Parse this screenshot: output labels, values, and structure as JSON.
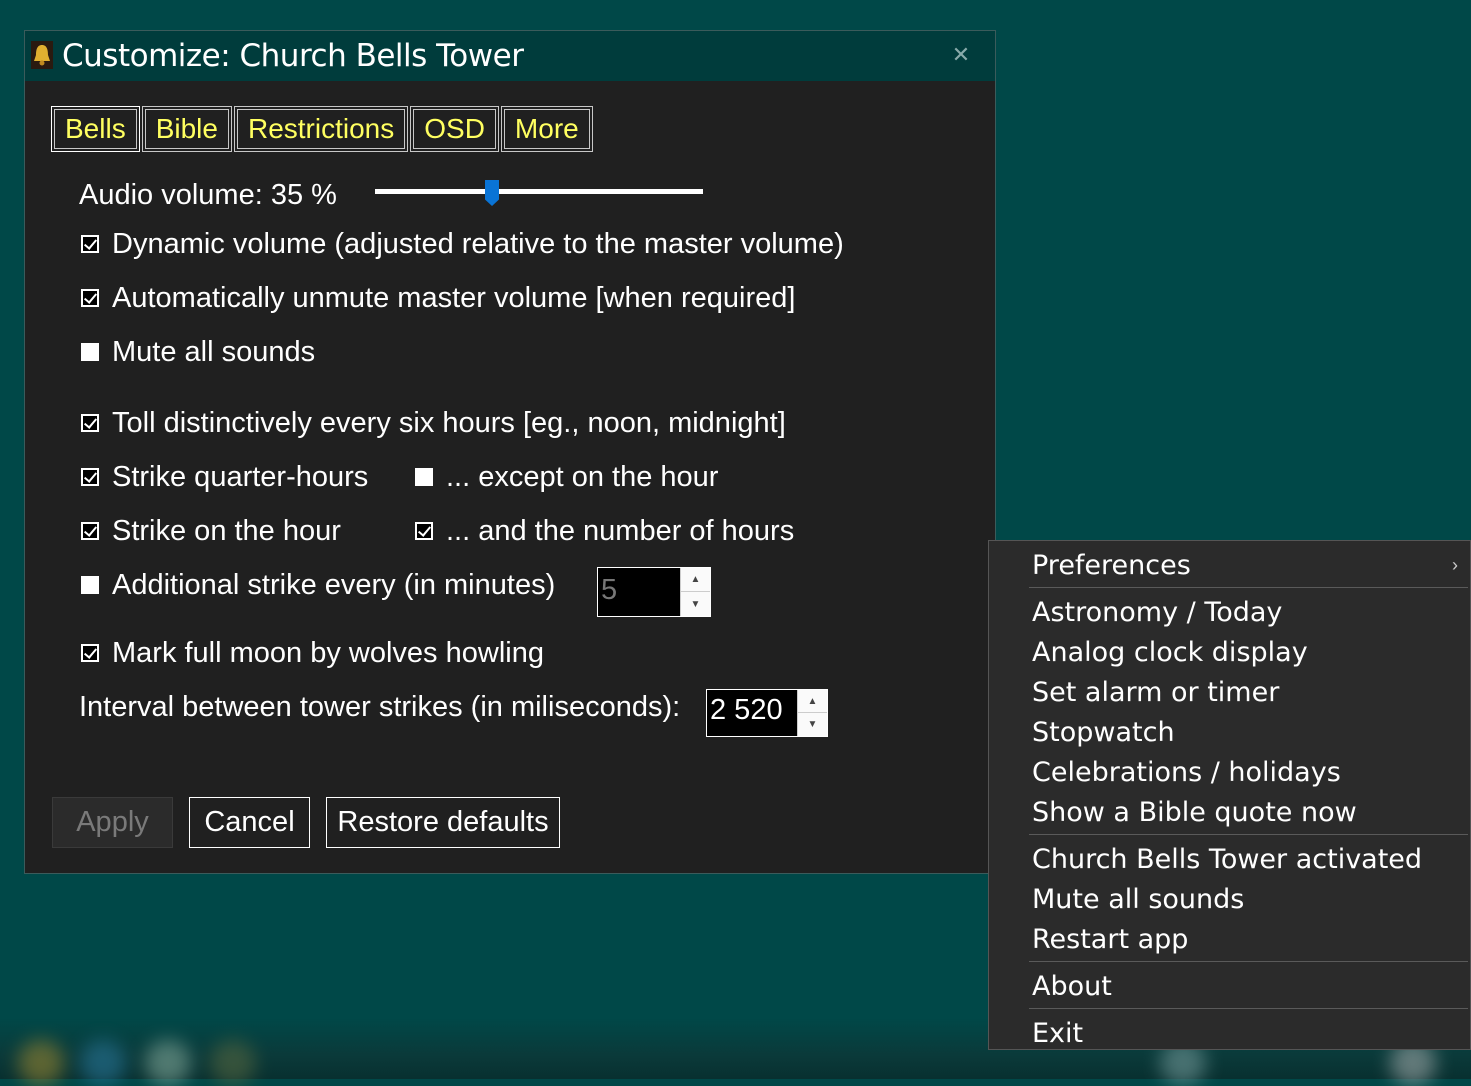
{
  "window": {
    "title": "Customize: Church Bells Tower",
    "close_glyph": "✕",
    "icon": "bell-icon"
  },
  "tabs": [
    "Bells",
    "Bible",
    "Restrictions",
    "OSD",
    "More"
  ],
  "bells": {
    "audio_volume_label": "Audio volume: 35 %",
    "audio_volume_percent": 35,
    "dynamic_volume": {
      "label": "Dynamic volume (adjusted relative to the master volume)",
      "checked": true
    },
    "auto_unmute": {
      "label": "Automatically unmute master volume [when required]",
      "checked": true
    },
    "mute_all": {
      "label": "Mute all sounds",
      "checked": false
    },
    "toll_six_hours": {
      "label": "Toll distinctively every six hours [eg., noon, midnight]",
      "checked": true
    },
    "strike_quarter": {
      "label": "Strike quarter-hours",
      "checked": true
    },
    "except_on_hour": {
      "label": "... except on the hour",
      "checked": false
    },
    "strike_hour": {
      "label": "Strike on the hour",
      "checked": true
    },
    "number_of_hours": {
      "label": "... and the number of hours",
      "checked": true
    },
    "additional_strike": {
      "label": "Additional strike every (in minutes)",
      "checked": false,
      "value": "5"
    },
    "full_moon": {
      "label": "Mark full moon by wolves howling",
      "checked": true
    },
    "interval_label": "Interval between tower strikes (in miliseconds):",
    "interval_value": "2 520"
  },
  "buttons": {
    "apply": "Apply",
    "cancel": "Cancel",
    "restore": "Restore defaults"
  },
  "context_menu": {
    "items": [
      "Preferences",
      "Astronomy / Today",
      "Analog clock display",
      "Set alarm or timer",
      "Stopwatch",
      "Celebrations / holidays",
      "Show a Bible quote now",
      "Church Bells Tower activated",
      "Mute all sounds",
      "Restart app",
      "About",
      "Exit"
    ],
    "submenu_glyph": "›"
  },
  "colors": {
    "desktop": "#004848",
    "tab_text": "#ffff60",
    "slider_thumb": "#0a74d6"
  }
}
